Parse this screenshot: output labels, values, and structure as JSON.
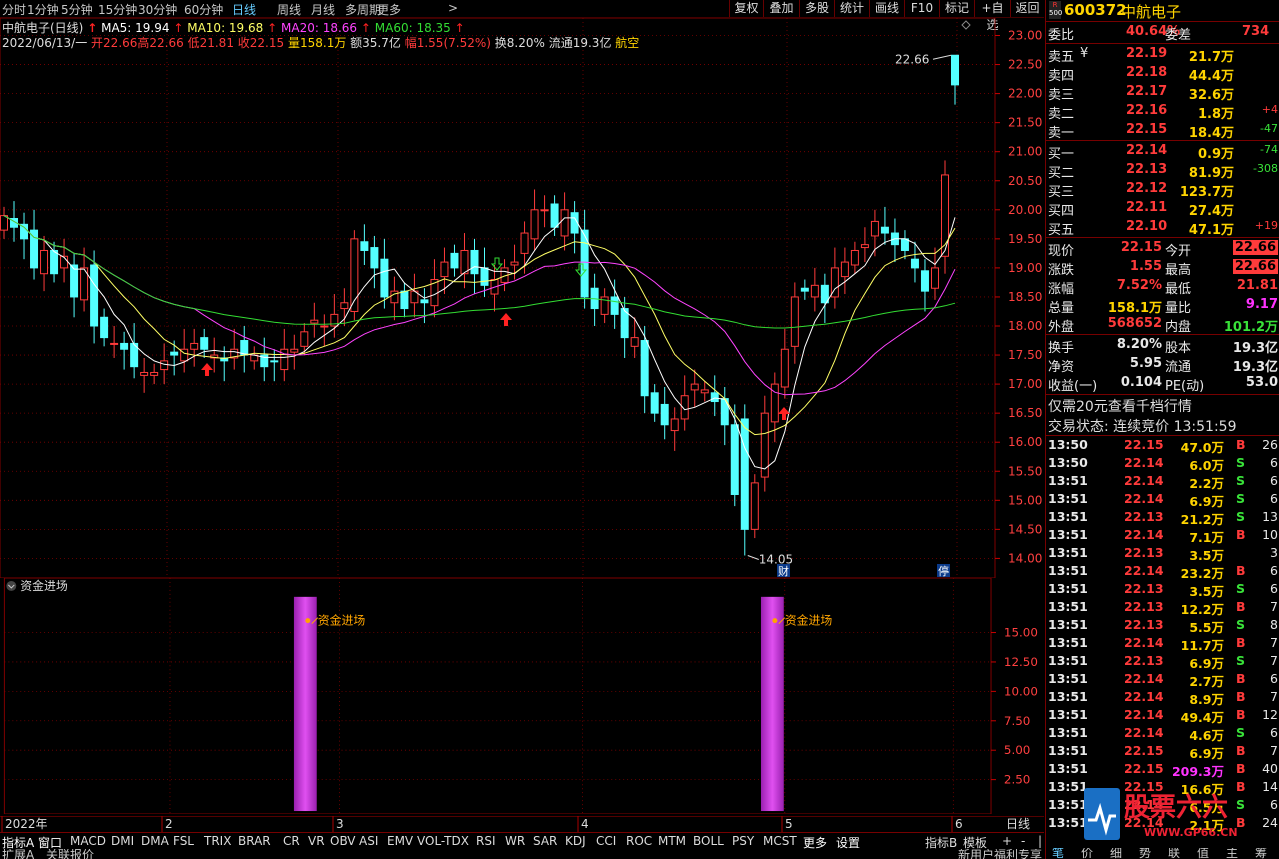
{
  "toolbar": {
    "tabs": [
      "分时",
      "1分钟",
      "5分钟",
      "15分钟",
      "30分钟",
      "60分钟",
      "日线",
      "周线",
      "月线",
      "多周期",
      "更多"
    ],
    "active_tab": "日线",
    "right_buttons": [
      "复权",
      "叠加",
      "多股",
      "统计",
      "画线",
      "F10",
      "标记",
      "+自选",
      "返回"
    ]
  },
  "main": {
    "title": "中航电子(日线)",
    "ma5": "MA5: 19.94",
    "ma10": "MA10: 19.68",
    "ma20": "MA20: 18.66",
    "ma60": "MA60: 18.35",
    "info_date": "2022/06/13/一",
    "info_open": "开22.66",
    "info_high": "高22.66",
    "info_low": "低21.81",
    "info_close": "收22.15",
    "info_vol": "量158.1万",
    "info_amt": "额35.7亿",
    "info_chg": "幅1.55(7.52%)",
    "info_turn": "换8.20%",
    "info_float": "流通19.3亿",
    "info_concept": "航空",
    "y_ticks": [
      "23.00",
      "22.50",
      "22.00",
      "21.50",
      "21.00",
      "20.50",
      "20.00",
      "19.50",
      "19.00",
      "18.50",
      "18.00",
      "17.50",
      "17.00",
      "16.50",
      "16.00",
      "15.50",
      "15.00",
      "14.50",
      "14.00"
    ],
    "high_label": "22.66",
    "low_label": "14.05",
    "badge_cai": "财",
    "badge_ting": "停"
  },
  "sub": {
    "title": "资金进场",
    "signal_label": "资金进场",
    "y_ticks": [
      "15.00",
      "12.50",
      "10.00",
      "7.50",
      "5.00",
      "2.50"
    ]
  },
  "time_axis": {
    "labels": [
      "2022年",
      "2",
      "3",
      "4",
      "5",
      "6"
    ],
    "period": "日线"
  },
  "bottom_tabs": [
    "指标A",
    "窗口",
    "MACD",
    "DMI",
    "DMA",
    "FSL",
    "TRIX",
    "BRAR",
    "CR",
    "VR",
    "OBV",
    "ASI",
    "EMV",
    "VOL-TDX",
    "RSI",
    "WR",
    "SAR",
    "KDJ",
    "CCI",
    "ROC",
    "MTM",
    "BOLL",
    "PSY",
    "MCST",
    "更多",
    "设置"
  ],
  "bottom_right": [
    "指标B",
    "模板",
    "+",
    "-",
    "|"
  ],
  "last_bar": {
    "left1": "扩展A",
    "left2": "关联报价",
    "right": "新用户福利专享"
  },
  "stock": {
    "code": "600372",
    "name": "中航电子",
    "badge": "R 500",
    "weibi_label": "委比",
    "weibi": "40.64%",
    "weicha_label": "委差",
    "weicha": "734",
    "asks": [
      {
        "label": "卖五",
        "price": "22.19",
        "vol": "21.7万",
        "chg": ""
      },
      {
        "label": "卖四",
        "price": "22.18",
        "vol": "44.4万",
        "chg": ""
      },
      {
        "label": "卖三",
        "price": "22.17",
        "vol": "32.6万",
        "chg": ""
      },
      {
        "label": "卖二",
        "price": "22.16",
        "vol": "1.8万",
        "chg": "+4"
      },
      {
        "label": "卖一",
        "price": "22.15",
        "vol": "18.4万",
        "chg": "-47"
      }
    ],
    "ask5_symbol": "¥",
    "bids": [
      {
        "label": "买一",
        "price": "22.14",
        "vol": "0.9万",
        "chg": "-74"
      },
      {
        "label": "买二",
        "price": "22.13",
        "vol": "81.9万",
        "chg": "-308"
      },
      {
        "label": "买三",
        "price": "22.12",
        "vol": "123.7万",
        "chg": ""
      },
      {
        "label": "买四",
        "price": "22.11",
        "vol": "27.4万",
        "chg": ""
      },
      {
        "label": "买五",
        "price": "22.10",
        "vol": "47.1万",
        "chg": "+19"
      }
    ],
    "stats": [
      {
        "l1": "现价",
        "v1": "22.15",
        "l2": "今开",
        "v2": "22.66"
      },
      {
        "l1": "涨跌",
        "v1": "1.55",
        "l2": "最高",
        "v2": "22.66"
      },
      {
        "l1": "涨幅",
        "v1": "7.52%",
        "l2": "最低",
        "v2": "21.81"
      },
      {
        "l1": "总量",
        "v1": "158.1万",
        "l2": "量比",
        "v2": "9.17"
      },
      {
        "l1": "外盘",
        "v1": "568652",
        "l2": "内盘",
        "v2": "101.2万"
      }
    ],
    "stats2": [
      {
        "l1": "换手",
        "v1": "8.20%",
        "l2": "股本",
        "v2": "19.3亿"
      },
      {
        "l1": "净资",
        "v1": "5.95",
        "l2": "流通",
        "v2": "19.3亿"
      },
      {
        "l1": "收益(一)",
        "v1": "0.104",
        "l2": "PE(动)",
        "v2": "53.0"
      }
    ],
    "promo": "仅需20元查看千档行情",
    "trade_state": "交易状态: 连续竞价 13:51:59"
  },
  "ticks": [
    {
      "t": "13:50",
      "p": "22.15",
      "v": "47.0万",
      "s": "B",
      "n": "26"
    },
    {
      "t": "13:50",
      "p": "22.14",
      "v": "6.0万",
      "s": "S",
      "n": "6"
    },
    {
      "t": "13:51",
      "p": "22.14",
      "v": "2.2万",
      "s": "S",
      "n": "6"
    },
    {
      "t": "13:51",
      "p": "22.14",
      "v": "6.9万",
      "s": "S",
      "n": "6"
    },
    {
      "t": "13:51",
      "p": "22.13",
      "v": "21.2万",
      "s": "S",
      "n": "13"
    },
    {
      "t": "13:51",
      "p": "22.14",
      "v": "7.1万",
      "s": "B",
      "n": "10"
    },
    {
      "t": "13:51",
      "p": "22.13",
      "v": "3.5万",
      "s": "",
      "n": "3"
    },
    {
      "t": "13:51",
      "p": "22.14",
      "v": "23.2万",
      "s": "B",
      "n": "6"
    },
    {
      "t": "13:51",
      "p": "22.13",
      "v": "3.5万",
      "s": "S",
      "n": "6"
    },
    {
      "t": "13:51",
      "p": "22.13",
      "v": "12.2万",
      "s": "B",
      "n": "7"
    },
    {
      "t": "13:51",
      "p": "22.13",
      "v": "5.5万",
      "s": "S",
      "n": "8"
    },
    {
      "t": "13:51",
      "p": "22.14",
      "v": "11.7万",
      "s": "B",
      "n": "7"
    },
    {
      "t": "13:51",
      "p": "22.13",
      "v": "6.9万",
      "s": "S",
      "n": "7"
    },
    {
      "t": "13:51",
      "p": "22.14",
      "v": "2.7万",
      "s": "B",
      "n": "6"
    },
    {
      "t": "13:51",
      "p": "22.14",
      "v": "8.9万",
      "s": "B",
      "n": "7"
    },
    {
      "t": "13:51",
      "p": "22.14",
      "v": "49.4万",
      "s": "B",
      "n": "12"
    },
    {
      "t": "13:51",
      "p": "22.14",
      "v": "4.6万",
      "s": "S",
      "n": "6"
    },
    {
      "t": "13:51",
      "p": "22.15",
      "v": "6.9万",
      "s": "B",
      "n": "7"
    },
    {
      "t": "13:51",
      "p": "22.15",
      "v": "209.3万",
      "s": "B",
      "n": "40"
    },
    {
      "t": "13:51",
      "p": "22.15",
      "v": "16.6万",
      "s": "B",
      "n": "14"
    },
    {
      "t": "13:51",
      "p": "22.14",
      "v": "6.5万",
      "s": "S",
      "n": "6"
    },
    {
      "t": "13:51",
      "p": "22.14",
      "v": "2.1万",
      "s": "B",
      "n": "24"
    }
  ],
  "right_tabs": [
    "笔",
    "价",
    "细",
    "势",
    "联",
    "值",
    "主",
    "筹"
  ],
  "watermark": {
    "title": "股票六六",
    "sub": "WWW.GP66.CN"
  },
  "colors": {
    "up": "#ff3b3b",
    "down": "#54ffff",
    "ma5": "#ffffff",
    "ma10": "#ffff66",
    "ma20": "#ff44ff",
    "ma60": "#33dd33",
    "grid": "#800000",
    "signal": "#cc33cc"
  }
}
